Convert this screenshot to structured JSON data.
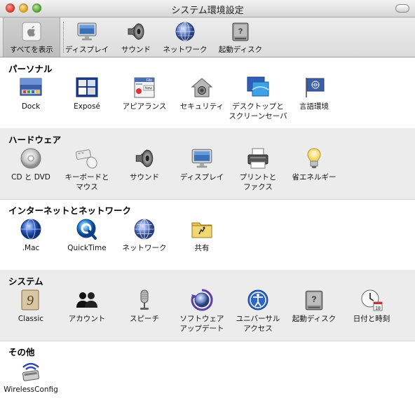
{
  "window": {
    "title": "システム環境設定"
  },
  "toolbar": {
    "items": [
      {
        "label": "すべてを表示",
        "icon": "apple-logo-icon"
      },
      {
        "label": "ディスプレイ",
        "icon": "display-icon"
      },
      {
        "label": "サウンド",
        "icon": "speaker-icon"
      },
      {
        "label": "ネットワーク",
        "icon": "globe-icon"
      },
      {
        "label": "起動ディスク",
        "icon": "hard-disk-icon"
      }
    ]
  },
  "sections": [
    {
      "title": "パーソナル",
      "panes": [
        {
          "label": "Dock",
          "icon": "dock-icon"
        },
        {
          "label": "Exposé",
          "icon": "expose-icon"
        },
        {
          "label": "アピアランス",
          "icon": "appearance-icon"
        },
        {
          "label": "セキュリティ",
          "icon": "security-house-icon"
        },
        {
          "label": "デスクトップと\nスクリーンセーバ",
          "icon": "desktop-icon"
        },
        {
          "label": "言語環境",
          "icon": "un-flag-icon"
        }
      ]
    },
    {
      "title": "ハードウェア",
      "panes": [
        {
          "label": "CD と DVD",
          "icon": "cd-icon"
        },
        {
          "label": "キーボードと\nマウス",
          "icon": "keyboard-mouse-icon"
        },
        {
          "label": "サウンド",
          "icon": "speaker-icon"
        },
        {
          "label": "ディスプレイ",
          "icon": "display-icon"
        },
        {
          "label": "プリントと\nファクス",
          "icon": "printer-icon"
        },
        {
          "label": "省エネルギー",
          "icon": "lightbulb-icon"
        }
      ]
    },
    {
      "title": "インターネットとネットワーク",
      "panes": [
        {
          "label": ".Mac",
          "icon": "dotmac-globe-icon"
        },
        {
          "label": "QuickTime",
          "icon": "quicktime-icon"
        },
        {
          "label": "ネットワーク",
          "icon": "globe-icon"
        },
        {
          "label": "共有",
          "icon": "sharing-folder-icon"
        }
      ]
    },
    {
      "title": "システム",
      "panes": [
        {
          "label": "Classic",
          "icon": "classic-icon"
        },
        {
          "label": "アカウント",
          "icon": "accounts-icon"
        },
        {
          "label": "スピーチ",
          "icon": "microphone-icon"
        },
        {
          "label": "ソフトウェア\nアップデート",
          "icon": "software-update-icon"
        },
        {
          "label": "ユニバーサル\nアクセス",
          "icon": "universal-access-icon"
        },
        {
          "label": "起動ディスク",
          "icon": "hard-disk-icon"
        },
        {
          "label": "日付と時刻",
          "icon": "clock-calendar-icon"
        }
      ]
    },
    {
      "title": "その他",
      "panes": [
        {
          "label": "WirelessConfig",
          "icon": "wireless-card-icon"
        }
      ]
    }
  ]
}
